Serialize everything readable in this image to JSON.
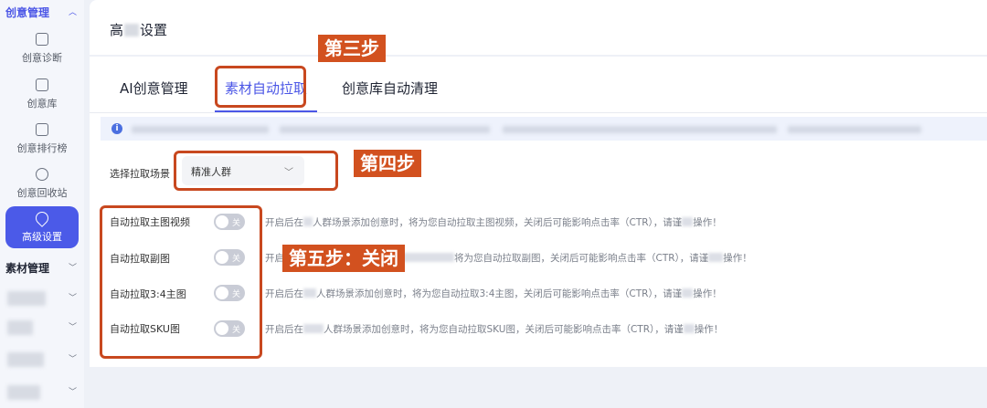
{
  "sidebar": {
    "group_creative": "创意管理",
    "items": [
      {
        "label": "创意诊断",
        "icon": "diagnosis-icon"
      },
      {
        "label": "创意库",
        "icon": "library-icon"
      },
      {
        "label": "创意排行榜",
        "icon": "ranking-icon"
      },
      {
        "label": "创意回收站",
        "icon": "recycle-bin-icon"
      },
      {
        "label": "高级设置",
        "icon": "settings-pin-icon"
      }
    ],
    "group_material": "素材管理"
  },
  "page": {
    "title_a": "高",
    "title_b": "设置"
  },
  "tabs": [
    {
      "label": "AI创意管理"
    },
    {
      "label": "素材自动拉取"
    },
    {
      "label": "创意库自动清理"
    }
  ],
  "scene": {
    "label": "选择拉取场景",
    "value": "精准人群"
  },
  "options": [
    {
      "label": "自动拉取主图视频",
      "state": "关",
      "desc_a": "开启后在",
      "desc_b": "人群场景添加创意时，将为您自动拉取主图视频，关闭后可能影响点击率（CTR），请谨",
      "desc_c": "操作！"
    },
    {
      "label": "自动拉取副图",
      "state": "关",
      "desc_a": "开启",
      "desc_b": "将为您自动拉取副图，关闭后可能影响点击率（CTR），请谨",
      "desc_c": "操作！"
    },
    {
      "label": "自动拉取3:4主图",
      "state": "关",
      "desc_a": "开启后在",
      "desc_b": "人群场景添加创意时，将为您自动拉取3:4主图，关闭后可能影响点击率（CTR），请谨",
      "desc_c": "操作！"
    },
    {
      "label": "自动拉取SKU图",
      "state": "关",
      "desc_a": "开启后在",
      "desc_b": "人群场景添加创意时，将为您自动拉取SKU图，关闭后可能影响点击率（CTR），请谨",
      "desc_c": "操作！"
    }
  ],
  "annotations": {
    "step3": "第三步",
    "step4": "第四步",
    "step5": "第五步：关闭"
  },
  "colors": {
    "accent": "#4b56e6",
    "annotation": "#d2511f"
  }
}
